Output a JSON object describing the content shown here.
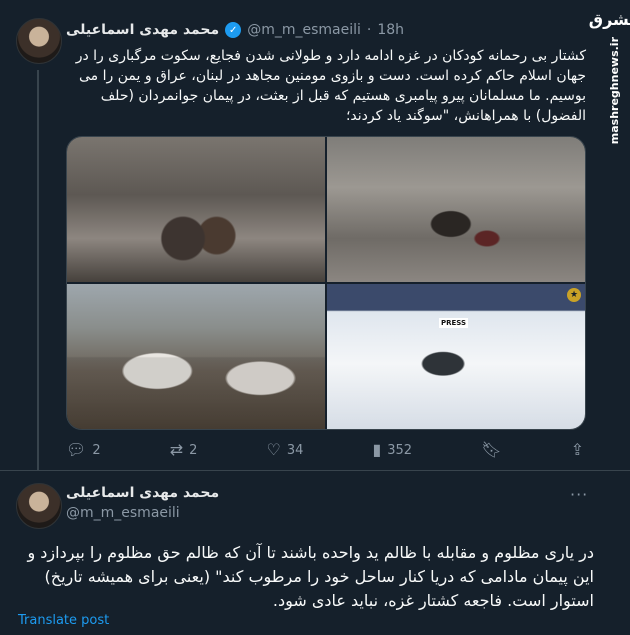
{
  "watermark": {
    "logo": "مشرق",
    "url": "mashreghnews.ir"
  },
  "tweet1": {
    "author_name": "محمد مهدی اسماعیلی",
    "verified_icon": "verified-check-icon",
    "handle": "@m_m_esmaeili",
    "separator": "·",
    "time": "18h",
    "text": "کشتار بی رحمانه کودکان در غزه ادامه دارد و طولانی شدن فجایع، سکوت مرگباری را در جهان اسلام حاکم کرده است. دست و بازوی مومنین مجاهد در لبنان، عراق و یمن را می بوسیم. ما مسلمانان پیرو پیامبری هستیم که قبل از بعثت، در پیمان جوانمردان (حلف الفضول) با همراهانش، \"سوگند یاد کردند؛",
    "media": {
      "press_tag": "PRESS",
      "badge": "★"
    },
    "actions": {
      "replies": "2",
      "retweets": "2",
      "likes": "34",
      "views": "352"
    }
  },
  "tweet2": {
    "author_name": "محمد مهدی اسماعیلی",
    "handle": "@m_m_esmaeili",
    "more_icon": "more-options-icon",
    "text": "در یاری مظلوم و مقابله با ظالم ید واحده باشند تا آن که ظالم حق مظلوم را بپردازد و این پیمان مادامی که دریا کنار ساحل خود را مرطوب کند\" (یعنی برای همیشه تاریخ) استوار است. فاجعه کشتار غزه، نباید عادی شود.",
    "translate_label": "Translate post"
  }
}
